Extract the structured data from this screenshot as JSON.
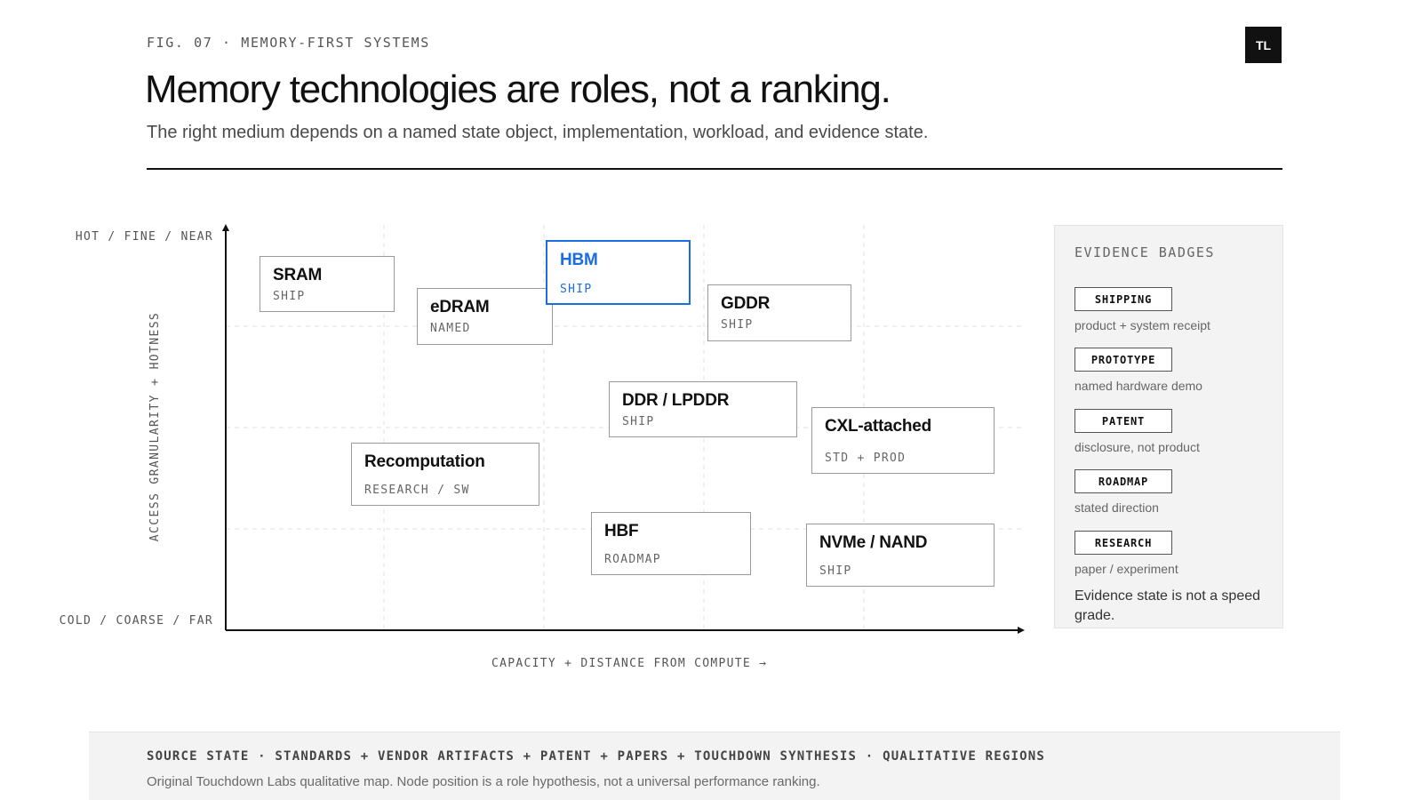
{
  "header": {
    "fig_label": "FIG. 07 · MEMORY-FIRST SYSTEMS",
    "logo_text": "TL",
    "title": "Memory technologies are roles, not a ranking.",
    "subtitle": "The right medium depends on a named state object, implementation, workload, and evidence state."
  },
  "diagram": {
    "y_axis_top": "HOT / FINE / NEAR",
    "y_axis_bottom": "COLD / COARSE / FAR",
    "y_axis_label": "ACCESS GRANULARITY + HOTNESS",
    "x_axis_label": "CAPACITY + DISTANCE FROM COMPUTE →",
    "accent_color": "#1a6ee0",
    "nodes": [
      {
        "name": "SRAM",
        "state": "SHIP",
        "highlighted": false
      },
      {
        "name": "eDRAM",
        "state": "NAMED",
        "highlighted": false
      },
      {
        "name": "HBM",
        "state": "SHIP",
        "highlighted": true
      },
      {
        "name": "GDDR",
        "state": "SHIP",
        "highlighted": false
      },
      {
        "name": "DDR / LPDDR",
        "state": "SHIP",
        "highlighted": false
      },
      {
        "name": "CXL-attached",
        "state": "STD + PROD",
        "highlighted": false
      },
      {
        "name": "Recomputation",
        "state": "RESEARCH / SW",
        "highlighted": false
      },
      {
        "name": "HBF",
        "state": "ROADMAP",
        "highlighted": false
      },
      {
        "name": "NVMe / NAND",
        "state": "SHIP",
        "highlighted": false
      }
    ]
  },
  "evidence_panel": {
    "title": "EVIDENCE BADGES",
    "badges": [
      {
        "label": "SHIPPING",
        "description": "product + system receipt"
      },
      {
        "label": "PROTOTYPE",
        "description": "named hardware demo"
      },
      {
        "label": "PATENT",
        "description": "disclosure, not product"
      },
      {
        "label": "ROADMAP",
        "description": "stated direction"
      },
      {
        "label": "RESEARCH",
        "description": "paper / experiment"
      }
    ],
    "note": "Evidence state is not a speed grade."
  },
  "footer": {
    "source": "SOURCE STATE · STANDARDS + VENDOR ARTIFACTS + PATENT + PAPERS + TOUCHDOWN SYNTHESIS · QUALITATIVE REGIONS",
    "note": "Original Touchdown Labs qualitative map. Node position is a role hypothesis, not a universal performance ranking."
  }
}
